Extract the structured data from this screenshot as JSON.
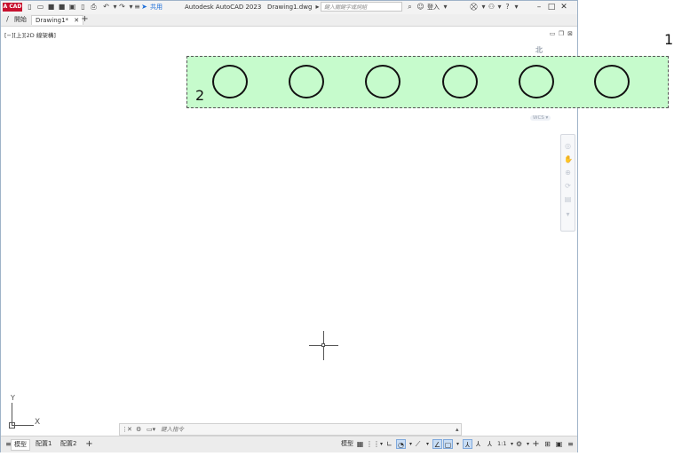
{
  "titlebar": {
    "logo_text": "A CAD",
    "share_label": "共用",
    "app_title": "Autodesk AutoCAD 2023",
    "document_name": "Drawing1.dwg",
    "search_placeholder": "鍵入關鍵字或詞組",
    "login_label": "登入"
  },
  "tabs": [
    {
      "label": "開始"
    },
    {
      "label": "Drawing1*"
    }
  ],
  "viewport": {
    "label": "[−][上][2D 線架構]",
    "north_label": "北",
    "wcs_label": "WCS"
  },
  "ucs": {
    "x_label": "X",
    "y_label": "Y"
  },
  "command_line": {
    "placeholder": "鍵入指令"
  },
  "status_tabs": [
    {
      "label": "模型"
    },
    {
      "label": "配置1"
    },
    {
      "label": "配置2"
    }
  ],
  "status": {
    "model_label": "模型",
    "scale_label": "1:1"
  },
  "annotations": {
    "label_1": "1",
    "label_2": "2"
  },
  "colors": {
    "highlight_fill": "#c6fbcc",
    "accent_blue": "#1e6fd9",
    "logo_red": "#c8102e"
  }
}
